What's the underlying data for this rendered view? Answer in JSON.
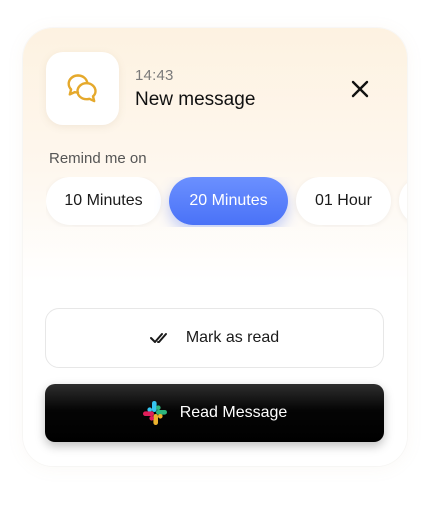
{
  "notification": {
    "time": "14:43",
    "title": "New message",
    "app_icon": "chat-bubbles-icon",
    "close_icon": "close-icon"
  },
  "reminder": {
    "label": "Remind me on",
    "options": [
      {
        "label": "10 Minutes",
        "selected": false
      },
      {
        "label": "20 Minutes",
        "selected": true
      },
      {
        "label": "01 Hour",
        "selected": false
      },
      {
        "label": "",
        "selected": false
      }
    ]
  },
  "actions": {
    "mark_read": {
      "label": "Mark as read",
      "icon": "double-check-icon"
    },
    "read_message": {
      "label": "Read Message",
      "icon": "slack-logo-icon"
    }
  },
  "colors": {
    "accent": "#4a72f7",
    "app_icon": "#e5a92c",
    "dark_button": "#000000"
  }
}
